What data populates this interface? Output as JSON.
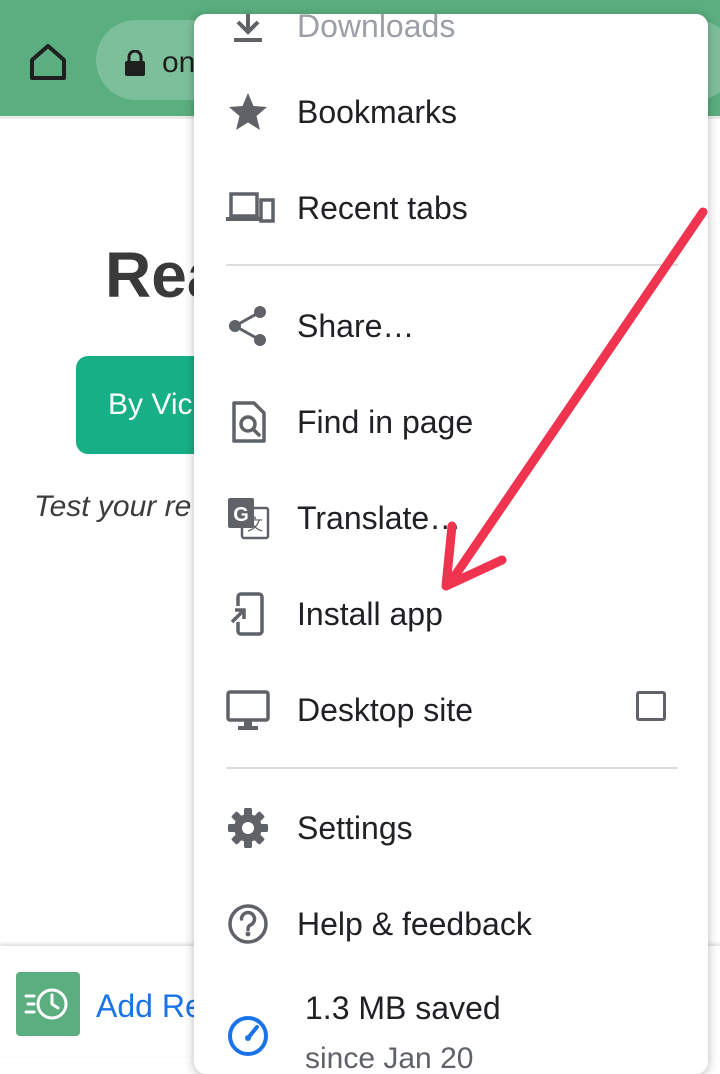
{
  "toolbar": {
    "url_fragment": "on"
  },
  "page": {
    "heading": "Rea",
    "author_button": "By Vic",
    "tagline": "Test your re",
    "bottom_bar_label": "Add Re"
  },
  "menu": {
    "downloads": "Downloads",
    "bookmarks": "Bookmarks",
    "recent_tabs": "Recent tabs",
    "share": "Share…",
    "find_in_page": "Find in page",
    "translate": "Translate…",
    "install_app": "Install app",
    "desktop_site": "Desktop site",
    "desktop_site_checked": false,
    "settings": "Settings",
    "help": "Help & feedback",
    "data_saved": "1.3 MB saved",
    "data_saved_since": "since Jan 20"
  },
  "colors": {
    "toolbar": "#5aae7f",
    "author_button": "#17b086",
    "link": "#1a73e8",
    "icon_gray": "#5f6368",
    "arrow": "#f0334f"
  },
  "icons": {
    "home": "home-icon",
    "lock": "lock-icon",
    "downloads": "download-icon",
    "bookmarks": "star-icon",
    "recent_tabs": "devices-icon",
    "share": "share-icon",
    "find_in_page": "find-in-page-icon",
    "translate": "translate-icon",
    "install_app": "install-app-icon",
    "desktop_site": "desktop-icon",
    "settings": "gear-icon",
    "help": "help-icon",
    "data_saved": "speedometer-icon",
    "add": "add-recent-icon"
  }
}
